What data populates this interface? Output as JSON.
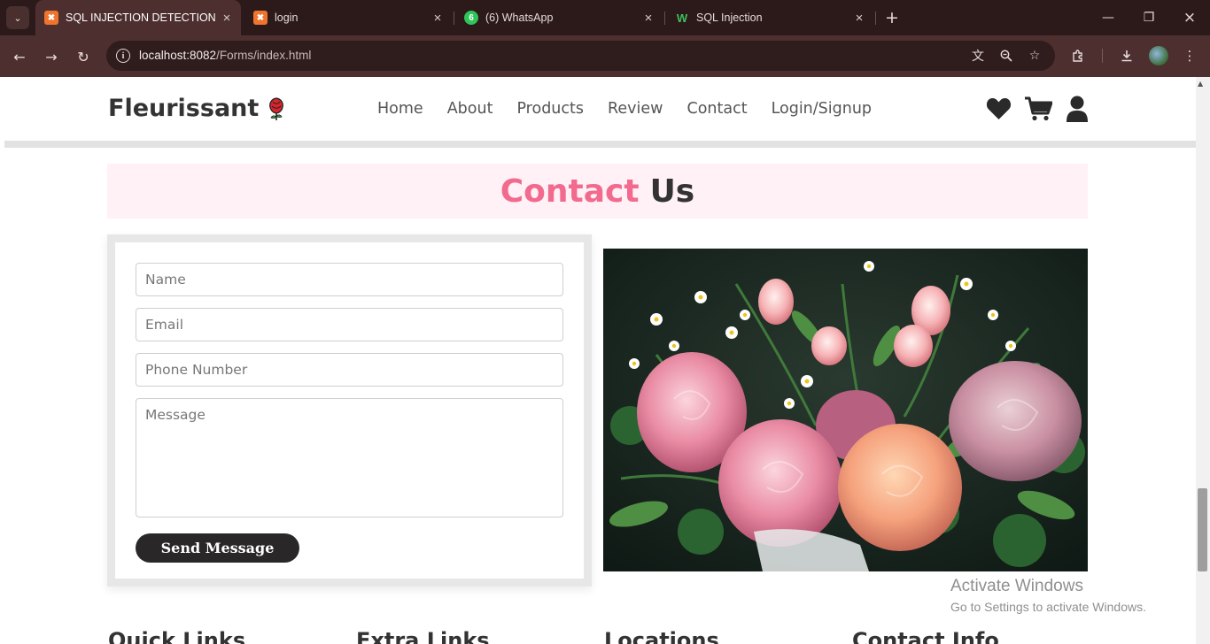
{
  "browser": {
    "tabs": [
      {
        "title": "SQL INJECTION DETECTION",
        "active": true,
        "favicon": "xampp-icon"
      },
      {
        "title": "login",
        "active": false,
        "favicon": "xampp-icon"
      },
      {
        "title": "(6) WhatsApp",
        "active": false,
        "favicon": "whatsapp-icon",
        "badge": "6"
      },
      {
        "title": "SQL Injection",
        "active": false,
        "favicon": "w3schools-icon"
      }
    ],
    "url_host": "localhost:8082",
    "url_path": "/Forms/index.html",
    "colors": {
      "tabbar": "#2c1a1a",
      "toolbar": "#4e2f2f"
    }
  },
  "site": {
    "brand": "Fleurissant",
    "nav": [
      "Home",
      "About",
      "Products",
      "Review",
      "Contact",
      "Login/Signup"
    ],
    "header_icons": [
      "heart-icon",
      "cart-icon",
      "user-icon"
    ]
  },
  "contact": {
    "heading_accent": "Contact",
    "heading_rest": "Us",
    "fields": {
      "name_placeholder": "Name",
      "email_placeholder": "Email",
      "phone_placeholder": "Phone Number",
      "message_placeholder": "Message"
    },
    "send_label": "Send Message",
    "colors": {
      "accent": "#f26a8d",
      "heading_bg": "#fff1f6",
      "button": "#2a2728"
    }
  },
  "watermark": {
    "line1": "Activate Windows",
    "line2": "Go to Settings to activate Windows."
  },
  "footer": {
    "titles": [
      "Quick Links",
      "Extra Links",
      "Locations",
      "Contact Info"
    ]
  }
}
